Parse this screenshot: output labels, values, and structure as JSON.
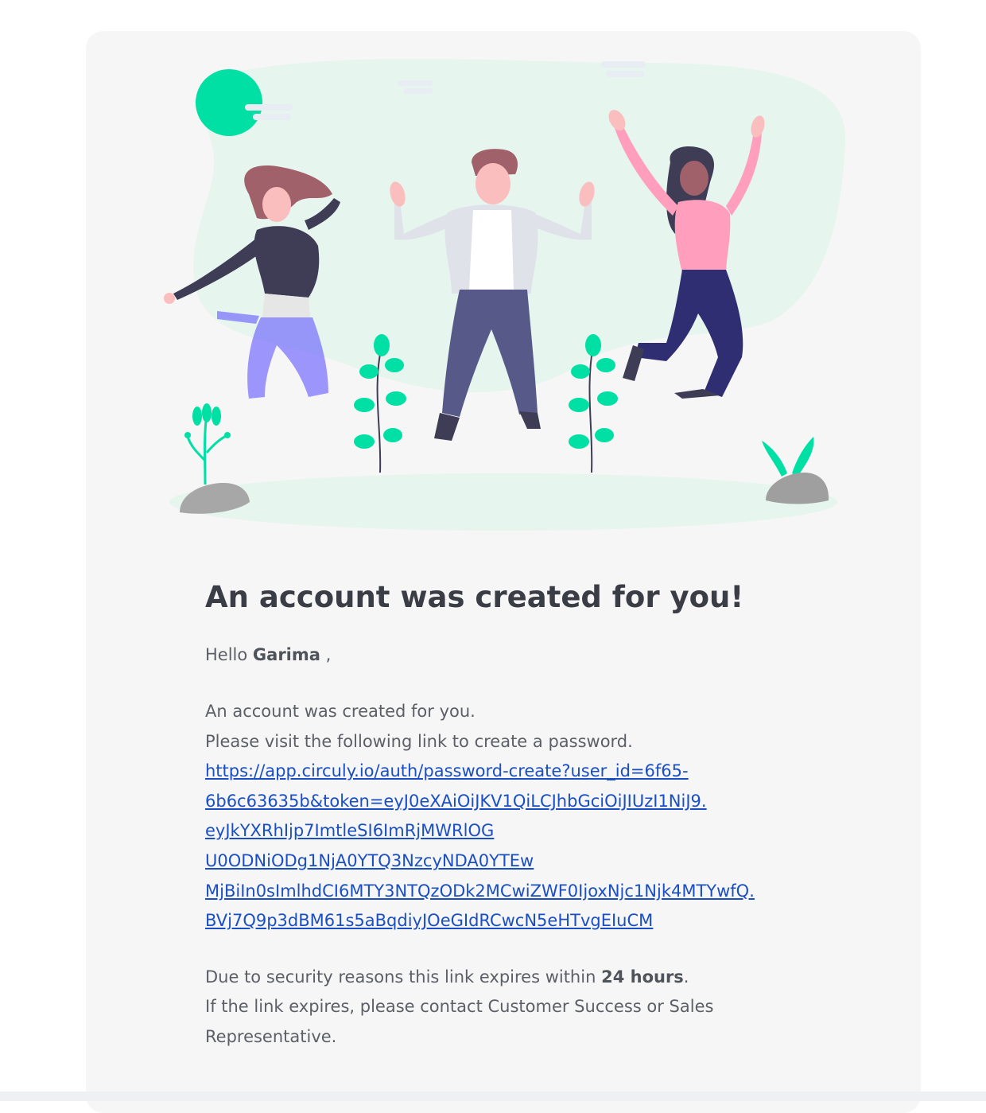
{
  "email": {
    "title": "An account was created for you!",
    "greeting_prefix": "Hello",
    "user_name": "Garima",
    "greeting_suffix": ",",
    "line1": "An account was created for you.",
    "line2": "Please visit the following link to create a password.",
    "link_lines": [
      "https://app.circuly.io/auth/password-create?user_id=6f65-",
      "6b6c63635b&token=eyJ0eXAiOiJKV1QiLCJhbGciOiJIUzI1NiJ9.",
      "eyJkYXRhIjp7ImtleSI6ImRjMWRlOG",
      "U0ODNiODg1NjA0YTQ3NzcyNDA0YTEw",
      "MjBiIn0sImlhdCI6MTY3NTQzODk2MCwiZWF0IjoxNjc1Njk4MTYwfQ.",
      "BVj7Q9p3dBM61s5aBqdiyJOeGIdRCwcN5eHTvgEIuCM"
    ],
    "expiry_prefix": "Due to security reasons this link expires within",
    "expiry_value": "24 hours",
    "expiry_suffix": ".",
    "contact_text": "If the link expires, please contact Customer Success or Sales Representative."
  },
  "colors": {
    "accent_green": "#00e0a4",
    "link_blue": "#1a4fc4",
    "card_background": "#f6f6f6"
  }
}
